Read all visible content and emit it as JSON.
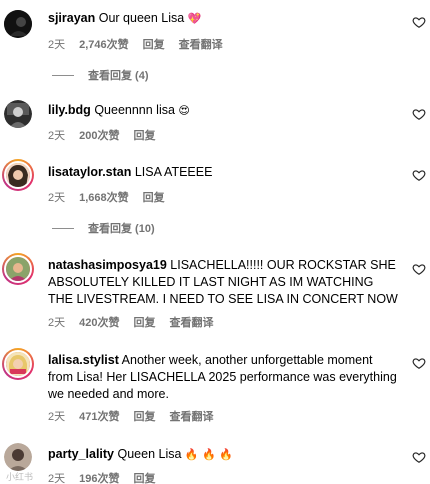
{
  "comments": [
    {
      "username": "sjirayan",
      "text": "Our queen Lisa",
      "emoji": "💖",
      "time": "2天",
      "likes": "2,746次赞",
      "reply": "回复",
      "translate": "查看翻译",
      "view_replies": "查看回复 (4)"
    },
    {
      "username": "lily.bdg",
      "text": "Queennnn lisa",
      "emoji": "😍",
      "time": "2天",
      "likes": "200次赞",
      "reply": "回复"
    },
    {
      "username": "lisataylor.stan",
      "text": "LISA ATEEEE",
      "time": "2天",
      "likes": "1,668次赞",
      "reply": "回复",
      "view_replies": "查看回复 (10)"
    },
    {
      "username": "natashasimposya19",
      "text": "LISACHELLA!!!!! OUR ROCKSTAR SHE ABSOLUTELY KILLED IT LAST NIGHT AS IM WATCHING THE LIVESTREAM. I NEED TO SEE LISA IN CONCERT NOW",
      "time": "2天",
      "likes": "420次赞",
      "reply": "回复",
      "translate": "查看翻译"
    },
    {
      "username": "lalisa.stylist",
      "text": "Another week, another unforgettable moment from Lisa! Her LISACHELLA 2025 performance was everything we needed and more.",
      "time": "2天",
      "likes": "471次赞",
      "reply": "回复",
      "translate": "查看翻译"
    },
    {
      "username": "party_lality",
      "text": "Queen Lisa",
      "emoji": "🔥 🔥 🔥",
      "time": "2天",
      "likes": "196次赞",
      "reply": "回复"
    }
  ],
  "watermark": "小红书",
  "colors": {
    "meta": "#737373",
    "heart_outline": "#262626",
    "accent_heart": "#e0245e"
  },
  "icons": {
    "like": "heart-outline-icon"
  }
}
